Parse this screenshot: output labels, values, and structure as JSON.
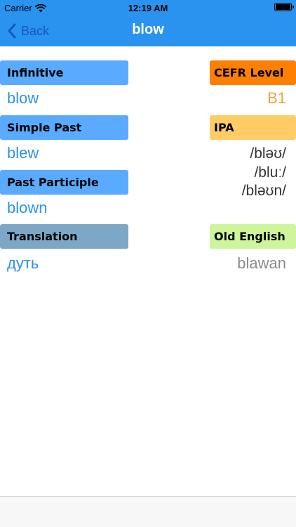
{
  "status": {
    "carrier": "Carrier",
    "time": "12:19 AM"
  },
  "nav": {
    "back_label": "Back",
    "title": "blow"
  },
  "rows": {
    "infinitive_label": "Infinitive",
    "infinitive_value": "blow",
    "simple_past_label": "Simple Past",
    "simple_past_value": "blew",
    "past_participle_label": "Past Participle",
    "past_participle_value": "blown",
    "translation_label": "Translation",
    "translation_value": "дуть"
  },
  "side": {
    "cefr_label": "CEFR Level",
    "cefr_value": "B1",
    "ipa_label": "IPA",
    "ipa_values": [
      "/bləʊ/",
      "/bluː/",
      "/bləʊn/"
    ],
    "old_english_label": "Old English",
    "old_english_value": "blawan"
  },
  "colors": {
    "nav_blue": "#2a93f0",
    "pill_blue": "#5aabff",
    "pill_gray_blue": "#7da7c7",
    "cefr_orange": "#ff7f00",
    "cefr_value_orange": "#f0a040",
    "ipa_yellow": "#ffcc66",
    "old_english_green": "#ccf59c"
  },
  "icons": {
    "wifi": "wifi-icon",
    "battery": "battery-icon",
    "back": "chevron-left-icon"
  }
}
